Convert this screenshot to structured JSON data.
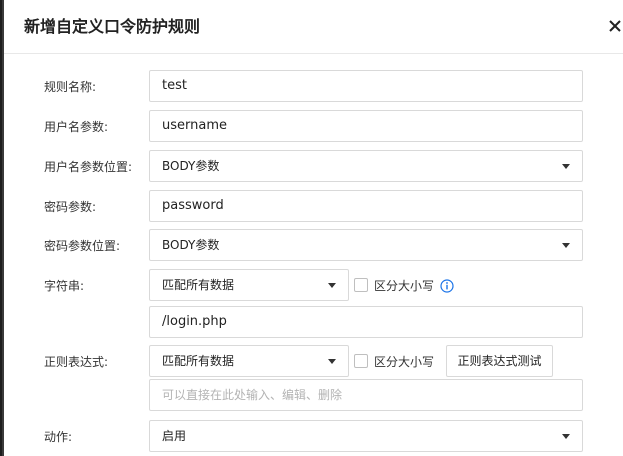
{
  "dialog": {
    "title": "新增自定义口令防护规则",
    "close_icon": "close-icon"
  },
  "form": {
    "rule_name": {
      "label": "规则名称:",
      "value": "test"
    },
    "username_param": {
      "label": "用户名参数:",
      "value": "username"
    },
    "username_param_location": {
      "label": "用户名参数位置:",
      "value": "BODY参数"
    },
    "password_param": {
      "label": "密码参数:",
      "value": "password"
    },
    "password_param_location": {
      "label": "密码参数位置:",
      "value": "BODY参数"
    },
    "string_match": {
      "label": "字符串:",
      "mode": "匹配所有数据",
      "case_sensitive_label": "区分大小写",
      "case_sensitive": false,
      "info_icon": "info-icon",
      "value": "/login.php"
    },
    "regex": {
      "label": "正则表达式:",
      "mode": "匹配所有数据",
      "case_sensitive_label": "区分大小写",
      "case_sensitive": false,
      "test_button": "正则表达式测试",
      "placeholder": "可以直接在此处输入、编辑、删除"
    },
    "action": {
      "label": "动作:",
      "value": "启用"
    }
  },
  "colors": {
    "info_blue": "#1a73e8",
    "border": "#d9d9d9",
    "placeholder": "#b3b3b3"
  }
}
